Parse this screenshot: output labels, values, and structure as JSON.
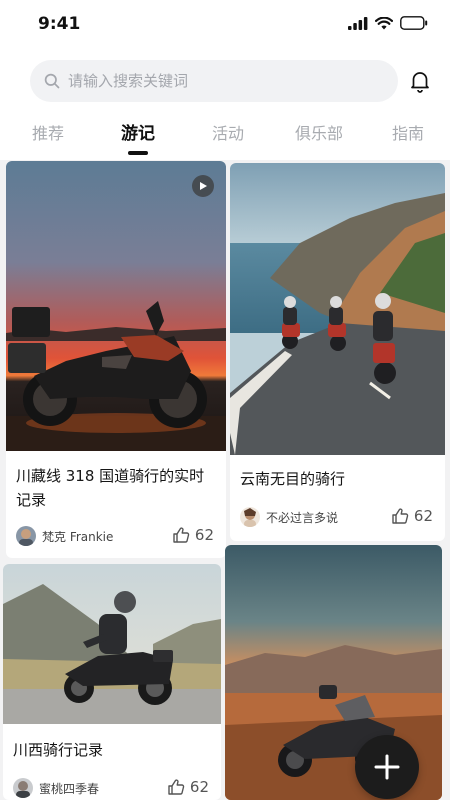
{
  "status_bar": {
    "time": "9:41"
  },
  "search": {
    "placeholder": "请输入搜索关键词"
  },
  "tabs": [
    {
      "label": "推荐"
    },
    {
      "label": "游记",
      "active": true
    },
    {
      "label": "活动"
    },
    {
      "label": "俱乐部"
    },
    {
      "label": "指南"
    }
  ],
  "posts": [
    {
      "title": "川藏线 318 国道骑行的实时记录",
      "author": "梵克 Frankie",
      "likes": "62",
      "is_video": true
    },
    {
      "title": "云南无目的骑行",
      "author": "不必过言多说",
      "likes": "62"
    },
    {
      "title": "川西骑行记录",
      "author": "蜜桃四季春",
      "likes": "62"
    },
    {
      "title": "",
      "author": "",
      "likes": ""
    }
  ],
  "fab": {
    "icon": "plus-icon"
  },
  "colors": {
    "accent": "#111111",
    "tab_inactive": "#a8abb0",
    "background": "#f2f2f3"
  }
}
